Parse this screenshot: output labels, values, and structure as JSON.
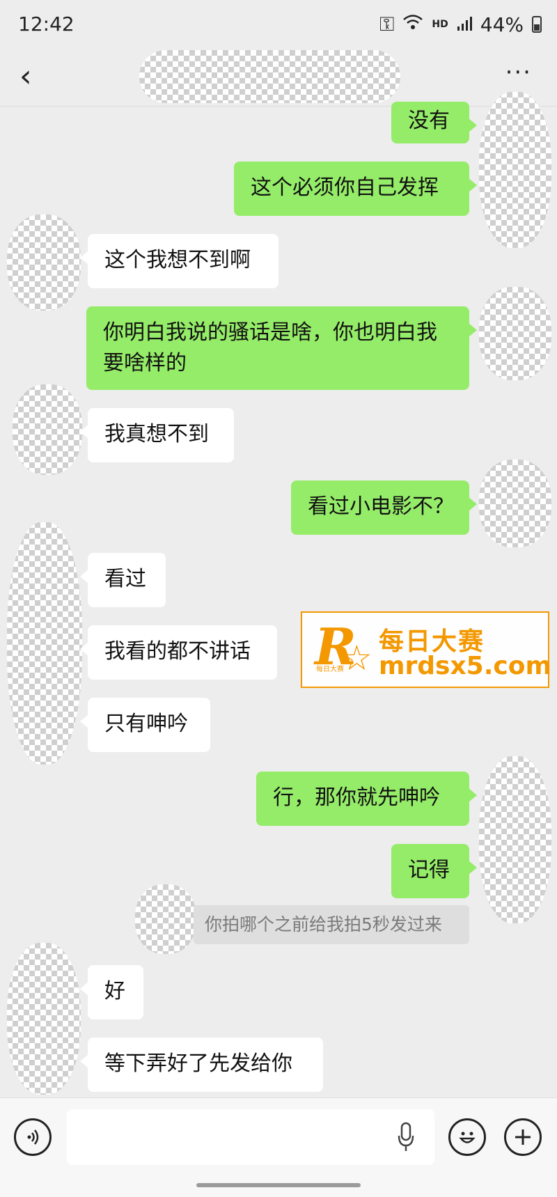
{
  "status_bar": {
    "time": "12:42",
    "network": "HD",
    "battery": "44%"
  },
  "header": {
    "back_icon": "chevron-left-icon",
    "more_label": "···"
  },
  "messages": [
    {
      "side": "sent",
      "text": "没有"
    },
    {
      "side": "sent",
      "text": "这个必须你自己发挥"
    },
    {
      "side": "received",
      "text": "这个我想不到啊"
    },
    {
      "side": "sent",
      "text": "你明白我说的骚话是啥，你也明白我要啥样的"
    },
    {
      "side": "received",
      "text": "我真想不到"
    },
    {
      "side": "sent",
      "text": "看过小电影不？"
    },
    {
      "side": "received",
      "text": "看过"
    },
    {
      "side": "received",
      "text": "我看的都不讲话"
    },
    {
      "side": "received",
      "text": "只有呻吟"
    },
    {
      "side": "sent",
      "text": "行，那你就先呻吟"
    },
    {
      "side": "sent",
      "text": "记得"
    },
    {
      "side": "quote",
      "text": "你拍哪个之前给我拍5秒发过来"
    },
    {
      "side": "received",
      "text": "好"
    },
    {
      "side": "received",
      "text": "等下弄好了先发给你"
    }
  ],
  "watermark": {
    "logo_letter": "R",
    "logo_small": "每日大赛",
    "line1": "每日大赛",
    "line2": "mrdsx5.com"
  },
  "input_bar": {
    "placeholder": "",
    "voice_icon": "voice-icon",
    "mic_icon": "mic-icon",
    "emoji_icon": "emoji-icon",
    "plus_icon": "plus-icon"
  },
  "colors": {
    "sent_bubble": "#95ec69",
    "received_bubble": "#ffffff",
    "background": "#ededed",
    "watermark": "#f39800"
  }
}
